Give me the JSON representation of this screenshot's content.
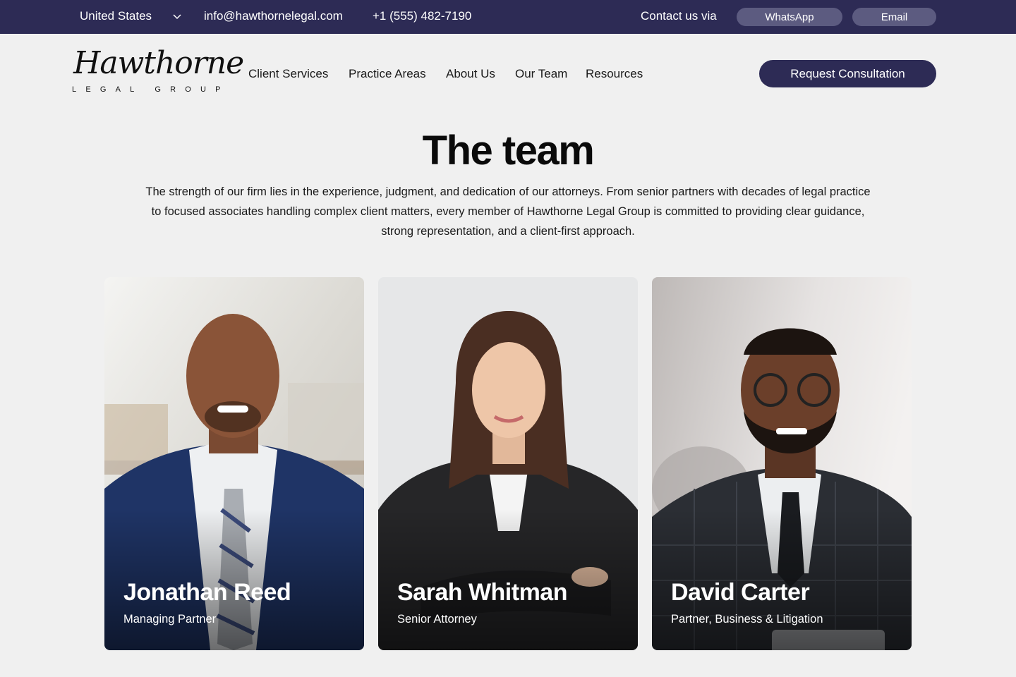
{
  "topbar": {
    "country": "United States",
    "email": "info@hawthornelegal.com",
    "phone": "+1 (555) 482-7190",
    "contact_label": "Contact us via",
    "whatsapp_label": "WhatsApp",
    "email_label": "Email"
  },
  "header": {
    "logo_script": "Hawthorne",
    "logo_sub": "LEGAL GROUP",
    "nav": [
      "Client Services",
      "Practice Areas",
      "About Us",
      "Our Team",
      "Resources"
    ],
    "cta_label": "Request Consultation"
  },
  "hero": {
    "title": "The team",
    "intro": "The strength of our firm lies in the experience, judgment, and dedication of our attorneys. From senior partners with decades of legal practice to focused associates handling complex client matters, every member of Hawthorne Legal Group is committed to providing clear guidance, strong representation, and a client-first approach."
  },
  "team": [
    {
      "name": "Jonathan Reed",
      "role": "Managing Partner"
    },
    {
      "name": "Sarah Whitman",
      "role": "Senior Attorney"
    },
    {
      "name": "David Carter",
      "role": "Partner, Business & Litigation"
    }
  ],
  "colors": {
    "brand": "#2d2b55",
    "pill": "#5c5b80",
    "background": "#f0f0f0"
  },
  "icons": {
    "country_dropdown": "chevron-down-icon"
  }
}
